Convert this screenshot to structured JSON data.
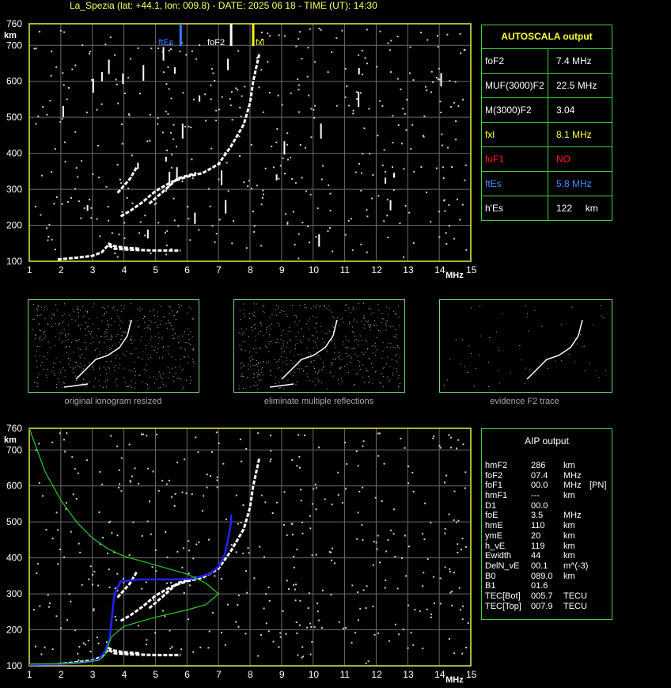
{
  "title": "La_Spezia (lat: +44.1, lon: 009.8) - DATE: 2025 06 18 - TIME (UT): 14:30",
  "chart_data": [
    {
      "type": "scatter",
      "name": "ionogram",
      "xlabel": "MHz",
      "ylabel": "km",
      "xlim": [
        1,
        15
      ],
      "ylim": [
        100,
        760
      ],
      "xticks": [
        1,
        2,
        3,
        4,
        5,
        6,
        7,
        8,
        9,
        10,
        11,
        12,
        13,
        14,
        15
      ],
      "yticks": [
        100,
        200,
        300,
        400,
        500,
        600,
        700,
        760
      ],
      "grid": true,
      "markers": [
        {
          "label": "ftEs",
          "x": 5.8,
          "color": "#2f7fff"
        },
        {
          "label": "foF2",
          "x": 7.4,
          "color": "#ffffff"
        },
        {
          "label": "fxl",
          "x": 8.1,
          "color": "#ffff00"
        }
      ],
      "traces": [
        {
          "name": "E/Es",
          "points": [
            [
              1.9,
              105
            ],
            [
              2.5,
              110
            ],
            [
              3.0,
              115
            ],
            [
              3.3,
              125
            ],
            [
              3.5,
              145
            ],
            [
              3.7,
              135
            ],
            [
              4.2,
              132
            ],
            [
              5.0,
              130
            ],
            [
              5.8,
              130
            ]
          ]
        },
        {
          "name": "F1",
          "points": [
            [
              3.5,
              150
            ],
            [
              3.7,
              142
            ],
            [
              4.0,
              138
            ],
            [
              4.5,
              135
            ]
          ]
        },
        {
          "name": "F2-o",
          "points": [
            [
              3.9,
              225
            ],
            [
              4.2,
              240
            ],
            [
              4.6,
              265
            ],
            [
              5.0,
              295
            ],
            [
              5.5,
              320
            ],
            [
              6.0,
              335
            ],
            [
              6.5,
              345
            ],
            [
              7.0,
              370
            ],
            [
              7.4,
              420
            ],
            [
              7.8,
              480
            ],
            [
              8.0,
              540
            ],
            [
              8.1,
              600
            ],
            [
              8.3,
              680
            ]
          ]
        },
        {
          "name": "F2-x",
          "points": [
            [
              4.8,
              260
            ],
            [
              5.2,
              290
            ],
            [
              5.7,
              330
            ],
            [
              6.3,
              345
            ]
          ]
        },
        {
          "name": "F2-x2",
          "points": [
            [
              3.8,
              290
            ],
            [
              4.2,
              330
            ],
            [
              4.4,
              360
            ]
          ]
        }
      ]
    },
    {
      "type": "line",
      "name": "aip-profile",
      "xlabel": "MHz",
      "ylabel": "km",
      "xlim": [
        1,
        15
      ],
      "ylim": [
        100,
        760
      ],
      "xticks": [
        1,
        2,
        3,
        4,
        5,
        6,
        7,
        8,
        9,
        10,
        11,
        12,
        13,
        14,
        15
      ],
      "yticks": [
        100,
        200,
        300,
        400,
        500,
        600,
        700,
        760
      ],
      "grid": true,
      "series": [
        {
          "color": "#2222ff",
          "points": [
            [
              1.0,
              103
            ],
            [
              2.0,
              105
            ],
            [
              2.8,
              110
            ],
            [
              3.2,
              118
            ],
            [
              3.4,
              140
            ],
            [
              3.55,
              175
            ],
            [
              3.7,
              300
            ],
            [
              3.9,
              335
            ],
            [
              4.5,
              340
            ],
            [
              5.5,
              340
            ],
            [
              6.2,
              342
            ],
            [
              6.7,
              355
            ],
            [
              7.0,
              375
            ],
            [
              7.2,
              410
            ],
            [
              7.3,
              450
            ],
            [
              7.4,
              500
            ],
            [
              7.4,
              520
            ]
          ]
        },
        {
          "color": "#22cc22",
          "points": [
            [
              1.0,
              760
            ],
            [
              1.5,
              640
            ],
            [
              2.0,
              560
            ],
            [
              2.5,
              500
            ],
            [
              3.0,
              455
            ],
            [
              3.5,
              425
            ],
            [
              4.0,
              405
            ],
            [
              5.0,
              380
            ],
            [
              6.0,
              355
            ],
            [
              6.6,
              330
            ],
            [
              7.0,
              300
            ],
            [
              6.6,
              270
            ],
            [
              6.0,
              255
            ],
            [
              5.0,
              235
            ],
            [
              4.0,
              210
            ],
            [
              3.6,
              180
            ],
            [
              3.5,
              155
            ],
            [
              3.4,
              130
            ],
            [
              3.2,
              115
            ],
            [
              2.5,
              108
            ],
            [
              1.0,
              105
            ]
          ]
        }
      ]
    }
  ],
  "autoscala": {
    "header": "AUTOSCALA output",
    "rows": [
      {
        "key": "foF2",
        "value": "7.4 MHz",
        "color": "#ffffff"
      },
      {
        "key": "MUF(3000)F2",
        "value": "22.5 MHz",
        "color": "#ffffff"
      },
      {
        "key": "M(3000)F2",
        "value": "3.04",
        "color": "#ffffff"
      },
      {
        "key": "fxl",
        "value": "8.1 MHz",
        "color": "#ffff33"
      },
      {
        "key": "foF1",
        "value": "NO",
        "color": "#ff2222"
      },
      {
        "key": "ftEs",
        "value": "5.8 MHz",
        "color": "#3f8fff"
      },
      {
        "key": "h'Es",
        "value": "122     km",
        "color": "#ffffff"
      }
    ]
  },
  "thumbnails": [
    {
      "caption": "original ionogram resized"
    },
    {
      "caption": "eliminate multiple reflections"
    },
    {
      "caption": "evidence F2 trace"
    }
  ],
  "aip": {
    "header": "AIP output",
    "rows": [
      [
        "hmF2",
        "286",
        "km",
        ""
      ],
      [
        "foF2",
        "07.4",
        "MHz",
        ""
      ],
      [
        "foF1",
        "00.0",
        "MHz",
        "[PN]"
      ],
      [
        "hmF1",
        "---",
        "km",
        ""
      ],
      [
        "D1",
        "00.0",
        "",
        ""
      ],
      [
        "foE",
        "3.5",
        "MHz",
        ""
      ],
      [
        "hmE",
        "110",
        "km",
        ""
      ],
      [
        "ymE",
        "20",
        "km",
        ""
      ],
      [
        "h_vE",
        "119",
        "km",
        ""
      ],
      [
        "Ewidth",
        "44",
        "km",
        ""
      ],
      [
        "DelN_vE",
        "00.1",
        "m^(-3)",
        ""
      ],
      [
        "B0",
        "089.0",
        "km",
        ""
      ],
      [
        "B1",
        "01.6",
        "",
        ""
      ],
      [
        "TEC[Bot]",
        "005.7",
        "TECU",
        ""
      ],
      [
        "TEC[Top]",
        "007.9",
        "TECU",
        ""
      ]
    ]
  }
}
